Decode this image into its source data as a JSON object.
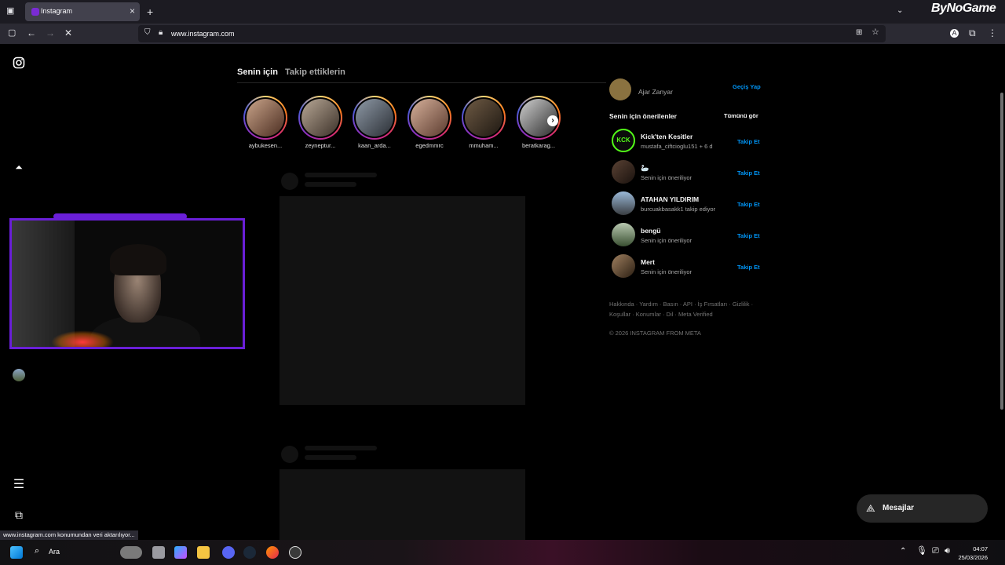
{
  "browser": {
    "tab_title": "Instagram",
    "url": "www.instagram.com",
    "new_tab": "+",
    "status_text": "www.instagram.com konumundan veri aktarılıyor..."
  },
  "brand_overlay": "ByNoGame",
  "feed": {
    "tabs": [
      "Senin için",
      "Takip ettiklerin"
    ],
    "stories": [
      {
        "name": "aybukesen..."
      },
      {
        "name": "zeyneptur..."
      },
      {
        "name": "kaan_arda..."
      },
      {
        "name": "egedmmrc"
      },
      {
        "name": "mmuham..."
      },
      {
        "name": "beratkarag..."
      }
    ]
  },
  "sidebar_right": {
    "account": {
      "display_name": "Ajar Zanyar",
      "switch_label": "Geçiş Yap"
    },
    "suggested_title": "Senin için önerilenler",
    "see_all": "Tümünü gör",
    "suggestions": [
      {
        "name": "Kick'ten Kesitler",
        "sub": "mustafa_ciftcioglu151 + 6 d",
        "action": "Takip Et"
      },
      {
        "name": "🦢",
        "sub": "Senin için öneriliyor",
        "action": "Takip Et"
      },
      {
        "name": "ATAHAN YILDIRIM",
        "sub": "burcuakbasakk1 takip ediyor",
        "action": "Takip Et"
      },
      {
        "name": "bengü",
        "sub": "Senin için öneriliyor",
        "action": "Takip Et"
      },
      {
        "name": "Mert",
        "sub": "Senin için öneriliyor",
        "action": "Takip Et"
      }
    ],
    "footer_links_1": "Hakkında · Yardım · Basın · API · İş Fırsatları · Gizlilik ·",
    "footer_links_2": "Koşullar · Konumlar · Dil · Meta Verified",
    "copyright": "© 2026 INSTAGRAM FROM META"
  },
  "messages_button": "Mesajlar",
  "taskbar": {
    "search_label": "Ara",
    "time": "04:07",
    "date": "25/03/2026"
  },
  "colors": {
    "follow": "#0095f6",
    "cam_border": "#6a1fd8"
  }
}
